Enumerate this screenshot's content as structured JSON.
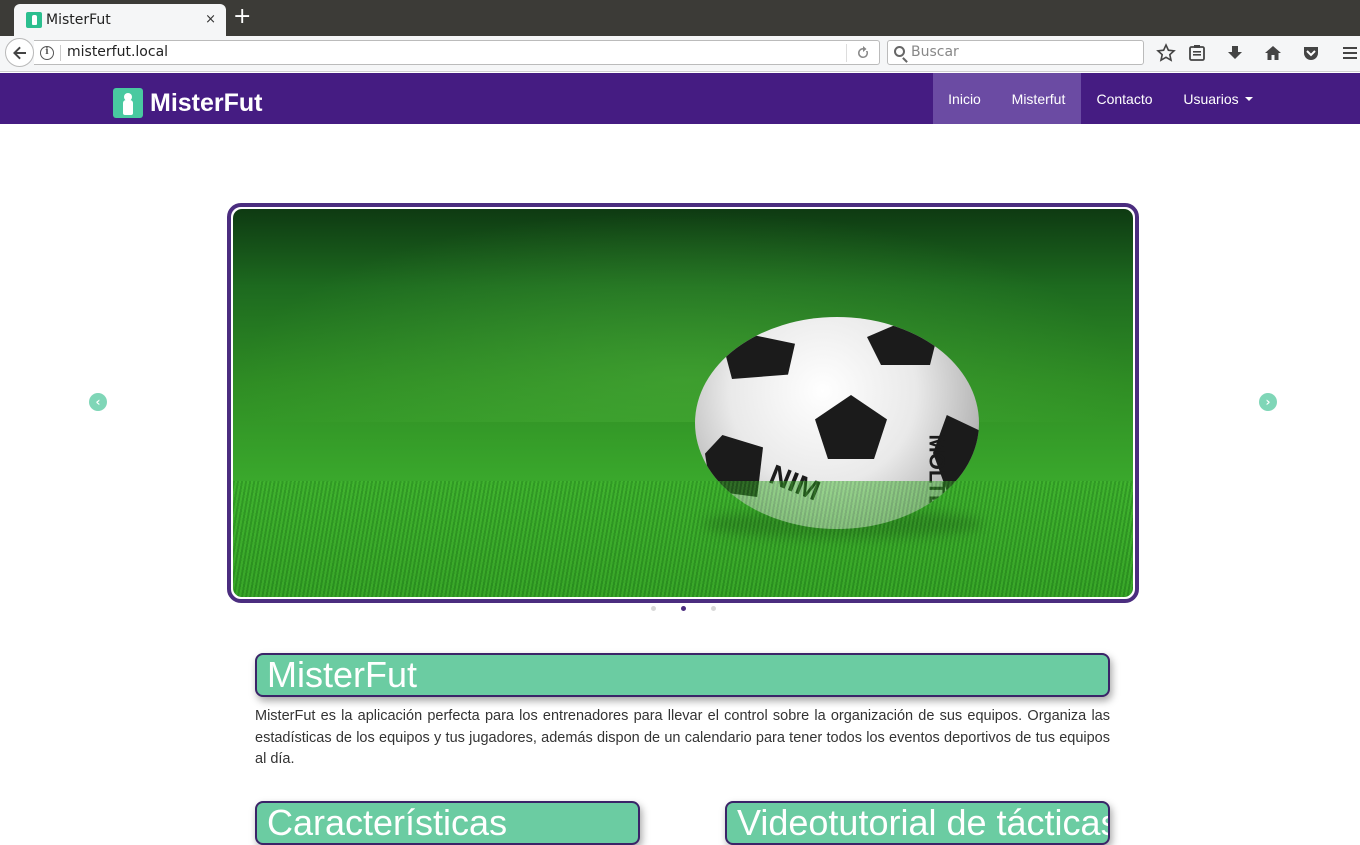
{
  "browser": {
    "tab_title": "MisterFut",
    "tab_close": "×",
    "new_tab": "+",
    "url": "misterfut.local",
    "search_placeholder": "Buscar",
    "icons": [
      "back-arrow-icon",
      "info-icon",
      "reload-icon",
      "search-icon",
      "star-icon",
      "reading-list-icon",
      "download-icon",
      "home-icon",
      "pocket-icon",
      "menu-icon"
    ]
  },
  "site": {
    "brand": "MisterFut",
    "nav": [
      {
        "label": "Inicio",
        "active": true
      },
      {
        "label": "Misterfut",
        "active": true
      },
      {
        "label": "Contacto",
        "active": false
      },
      {
        "label": "Usuarios",
        "active": false,
        "dropdown": true
      }
    ],
    "colors": {
      "navbar": "#451c82",
      "nav_active": "#6b4ba3",
      "accent": "#6bcca2",
      "frame": "#4b2d7f"
    }
  },
  "carousel": {
    "prev": "‹",
    "next": "›",
    "slides": 3,
    "active_slide": 2,
    "ball_text_1": "NIM",
    "ball_text_2": "MOLTEN"
  },
  "content": {
    "main_title": "MisterFut",
    "intro": "MisterFut es la aplicación perfecta para los entrenadores para llevar el control sobre la organización de sus equipos. Organiza las estadísticas de los equipos y tus jugadores, además dispon de un calendario para tener todos los eventos deportivos de tus equipos al día.",
    "features_title": "Características",
    "video_title": "Videotutorial de tácticas"
  }
}
